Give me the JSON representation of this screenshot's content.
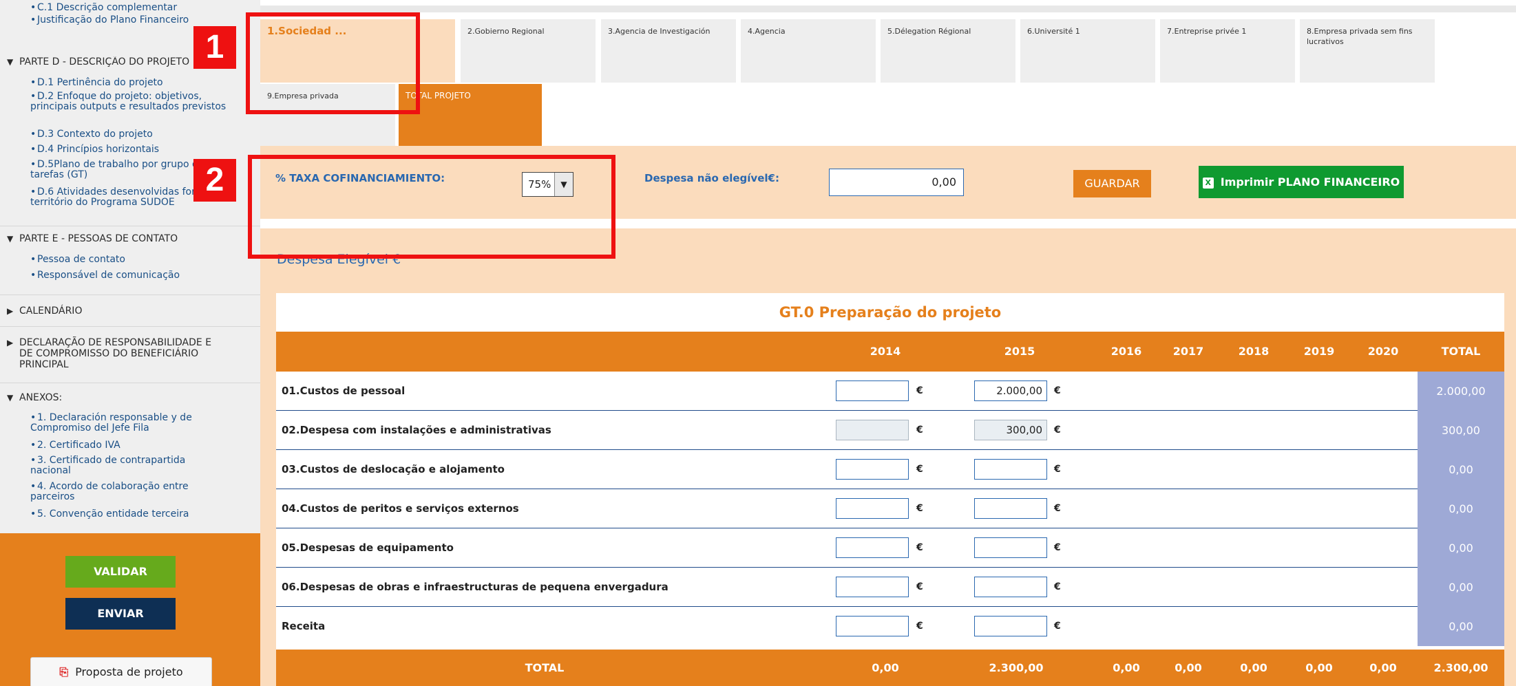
{
  "sidebar": {
    "partC_items": [
      "C.1 Descrição complementar",
      "Justificação do Plano Financeiro"
    ],
    "partD_header": "PARTE D - DESCRIÇÃO DO PROJETO",
    "partD_items": [
      "D.1 Pertinência do projeto",
      "D.2 Enfoque do projeto: objetivos, principais outputs e resultados previstos",
      "D.3 Contexto do projeto",
      "D.4 Princípios horizontais",
      "D.5Plano de trabalho por grupo de tarefas (GT)",
      "D.6 Atividades desenvolvidas fora do território do Programa SUDOE"
    ],
    "partE_header": "PARTE E - PESSOAS DE CONTATO",
    "partE_items": [
      "Pessoa de contato",
      "Responsável de comunicação"
    ],
    "calendario": "CALENDÁRIO",
    "declaracao": "DECLARAÇÃO DE RESPONSABILIDADE E DE COMPROMISSO DO BENEFICIÁRIO PRINCIPAL",
    "anexos_header": "ANEXOS:",
    "anexos_items": [
      "1. Declaración responsable y de Compromiso del Jefe Fila",
      "2. Certificado IVA",
      "3. Certificado de contrapartida nacional",
      "4. Acordo de colaboração entre parceiros",
      "5. Convenção entidade terceira"
    ],
    "validar": "VALIDAR",
    "enviar": "ENVIAR",
    "proposta": "Proposta de projeto"
  },
  "tabs": [
    "1.Sociedad ...",
    "2.Gobierno Regional",
    "3.Agencia de Investigación",
    "4.Agencia",
    "5.Délegation Régional",
    "6.Université 1",
    "7.Entreprise privée 1",
    "8.Empresa privada sem fins lucrativos",
    "9.Empresa privada",
    "TOTAL PROJETO"
  ],
  "config": {
    "taxa_label": "% TAXA COFINANCIAMIENTO:",
    "taxa_value": "75%",
    "nao_elegivel_label": "Despesa não elegível€:",
    "nao_elegivel_value": "0,00",
    "guardar": "GUARDAR",
    "imprimir": "Imprimir PLANO FINANCEIRO",
    "despesa_elegivel": "Despesa Elegível €"
  },
  "table": {
    "title": "GT.0 Preparação do projeto",
    "columns": [
      "2014",
      "2015",
      "2016",
      "2017",
      "2018",
      "2019",
      "2020",
      "TOTAL"
    ],
    "rows": [
      {
        "label": "01.Custos de pessoal",
        "v2014": "",
        "v2015": "2.000,00",
        "total": "2.000,00"
      },
      {
        "label": "02.Despesa com instalações e administrativas",
        "v2014": "",
        "v2015": "300,00",
        "total": "300,00"
      },
      {
        "label": "03.Custos de deslocação e alojamento",
        "v2014": "",
        "v2015": "",
        "total": "0,00"
      },
      {
        "label": "04.Custos de peritos e serviços externos",
        "v2014": "",
        "v2015": "",
        "total": "0,00"
      },
      {
        "label": "05.Despesas de equipamento",
        "v2014": "",
        "v2015": "",
        "total": "0,00"
      },
      {
        "label": "06.Despesas de obras e infraestructuras de pequena envergadura",
        "v2014": "",
        "v2015": "",
        "total": "0,00"
      },
      {
        "label": "Receita",
        "v2014": "",
        "v2015": "",
        "total": "0,00"
      }
    ],
    "euro": "€",
    "footer": {
      "label": "TOTAL",
      "values": [
        "0,00",
        "2.300,00",
        "0,00",
        "0,00",
        "0,00",
        "0,00",
        "0,00",
        "2.300,00"
      ]
    }
  },
  "highlights": [
    "1",
    "2"
  ],
  "colors": {
    "orange": "#e5801c",
    "peach": "#fbdcbd",
    "blue": "#2a68b0",
    "green": "#0f9a30",
    "red": "#ee1111",
    "navy": "#0e2f54"
  }
}
